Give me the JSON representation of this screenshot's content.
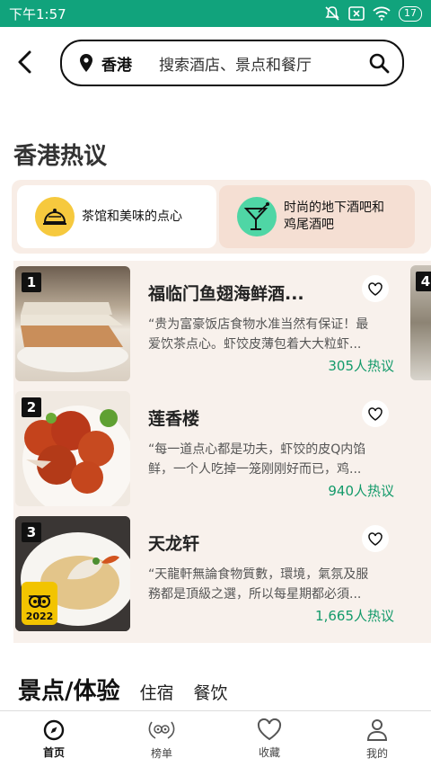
{
  "status_bar": {
    "time": "下午1:57",
    "battery": "17"
  },
  "header": {
    "location": "香港",
    "search_placeholder": "搜索酒店、景点和餐厅"
  },
  "section_title": "香港热议",
  "categories": [
    {
      "label": "茶馆和美味的点心",
      "icon": "bell-icon",
      "color": "#f6c93e"
    },
    {
      "label_line1": "时尚的地下酒吧和",
      "label_line2": "鸡尾酒吧",
      "icon": "cocktail-icon",
      "color": "#4fd6a5"
    }
  ],
  "restaurants": [
    {
      "rank": "1",
      "name": "福临门鱼翅海鲜酒...",
      "quote_line1": "“贵为富豪饭店食物水准当然有保证！最",
      "quote_line2": "爱饮茶点心。虾饺皮薄包着大大粒虾...",
      "buzz": "305人热议"
    },
    {
      "rank": "2",
      "name": "莲香楼",
      "quote_line1": "“每一道点心都是功夫，虾饺的皮Q内馅",
      "quote_line2": "鲜，一个人吃掉一笼刚刚好而已，鸡...",
      "buzz": "940人热议"
    },
    {
      "rank": "3",
      "name": "天龙轩",
      "quote_line1": "“天龍軒無論食物質數，環境，氣氛及服",
      "quote_line2": "務都是頂級之選，所以每星期都必須...",
      "buzz": "1,665人热议",
      "award_year": "2022"
    }
  ],
  "peek_rank": "4",
  "bottom_section": {
    "tab_active": "景点/体验",
    "tab_2": "住宿",
    "tab_3": "餐饮"
  },
  "nav": [
    {
      "label": "首页",
      "icon": "compass-icon"
    },
    {
      "label": "榜单",
      "icon": "laurel-icon"
    },
    {
      "label": "收藏",
      "icon": "heart-icon"
    },
    {
      "label": "我的",
      "icon": "profile-icon"
    }
  ],
  "colors": {
    "brand": "#11a37c",
    "buzz": "#139a6a",
    "panel": "#f8f1ec"
  }
}
